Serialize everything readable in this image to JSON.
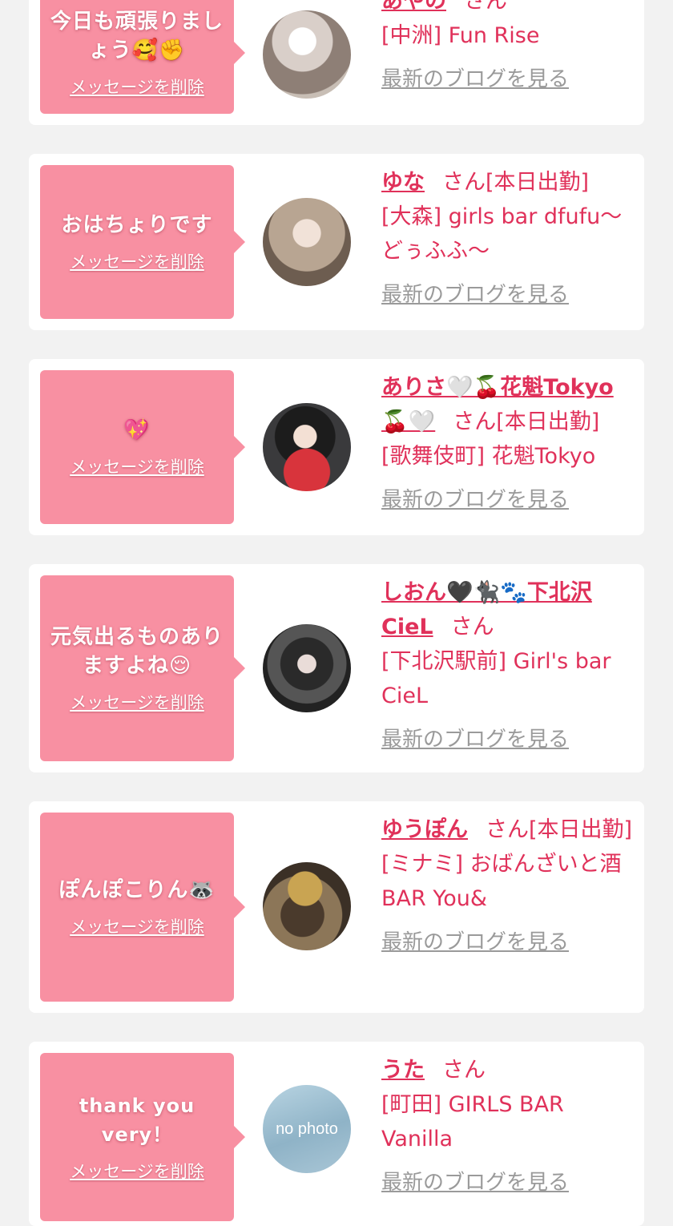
{
  "delete_label": "メッセージを削除",
  "blog_label": "最新のブログを見る",
  "san_label": "さん",
  "cards": [
    {
      "message": "今日も頑張りましょう🥰✊",
      "name": "あやの",
      "status": "",
      "shop": "[中洲] Fun Rise",
      "avatar_icon": "user-photo-icon"
    },
    {
      "message": "おはちょりです",
      "name": "ゆな",
      "status": "[本日出勤]",
      "shop": "[大森] girls bar dfufu〜どぅふふ〜",
      "avatar_icon": "user-photo-icon"
    },
    {
      "message": "💖",
      "name": "ありさ🤍🍒花魁Tokyo🍒🤍",
      "status": "[本日出勤]",
      "shop": "[歌舞伎町] 花魁Tokyo",
      "avatar_icon": "user-photo-icon"
    },
    {
      "message": "元気出るものありますよね😌",
      "name": "しおん🖤🐈‍⬛🐾下北沢CieL",
      "status": "",
      "shop": "[下北沢駅前] Girl's bar CieL",
      "avatar_icon": "user-photo-icon"
    },
    {
      "message": "ぽんぽこりん🦝",
      "name": "ゆうぽん",
      "status": "[本日出勤]",
      "shop": "[ミナミ] おばんざいと酒BAR You&",
      "avatar_icon": "tanuki-photo-icon"
    },
    {
      "message": "thank you very！",
      "name": "うた",
      "status": "",
      "shop": "[町田] GIRLS BAR Vanilla",
      "avatar_icon": "no-photo-icon",
      "avatar_text": "no photo"
    }
  ],
  "colors": {
    "bubble": "#f890a2",
    "accent": "#e0315a",
    "link_gray": "#9a9a9a",
    "background": "#f2f2f2"
  }
}
